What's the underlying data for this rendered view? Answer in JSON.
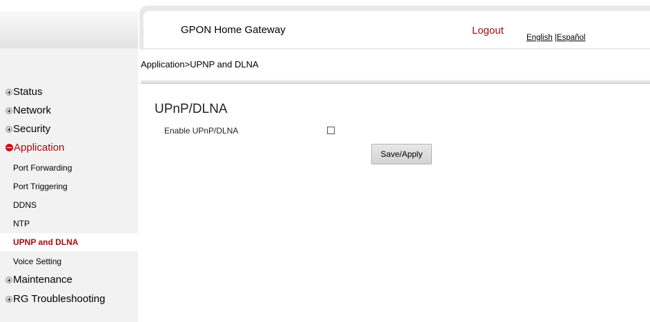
{
  "header": {
    "title": "GPON Home Gateway",
    "logout_label": "Logout",
    "lang_english": "English",
    "lang_separator": " |",
    "lang_spanish": "Español"
  },
  "breadcrumb": "Application>UPNP and DLNA",
  "sidebar": {
    "status": "Status",
    "network": "Network",
    "security": "Security",
    "application": "Application",
    "sub_items": [
      "Port Forwarding",
      "Port Triggering",
      "DDNS",
      "NTP",
      "UPNP and DLNA",
      "Voice Setting"
    ],
    "selected_item": "UPNP and DLNA",
    "maintenance": "Maintenance",
    "troubleshooting": "RG Troubleshooting"
  },
  "main": {
    "section_title": "UPnP/DLNA",
    "enable_label": "Enable UPnP/DLNA",
    "enable_checked": false,
    "save_label": "Save/Apply"
  },
  "colors": {
    "accent": "#a10d0d",
    "sidebar_bg": "#f2f2f2",
    "header_bg": "#e9e9e9"
  }
}
